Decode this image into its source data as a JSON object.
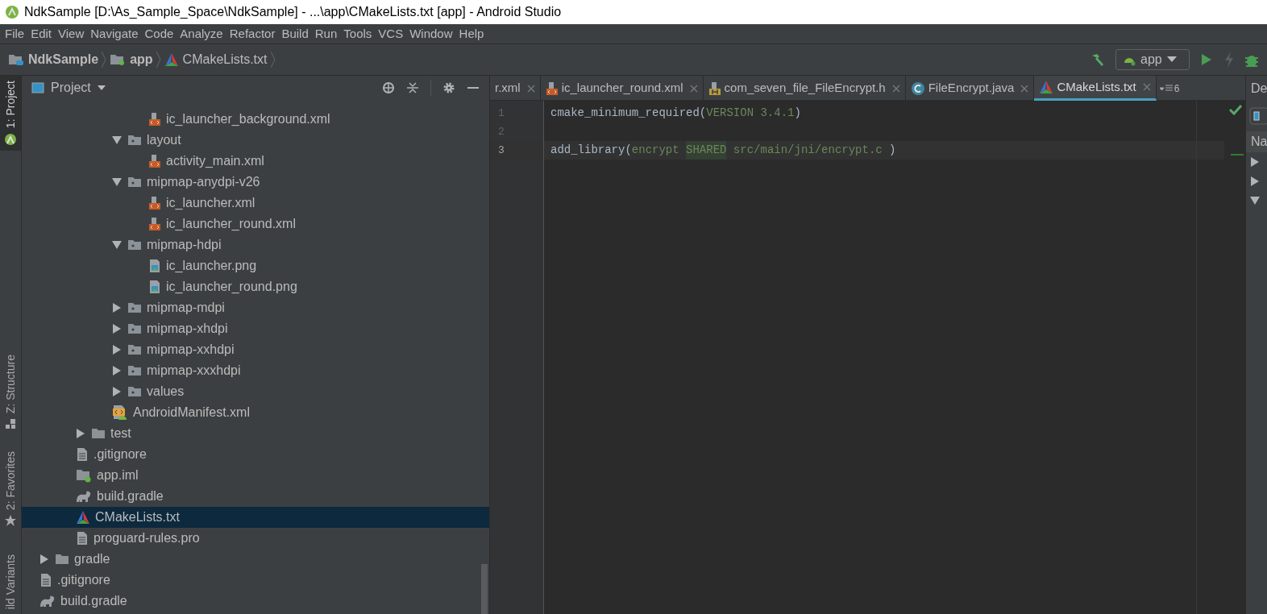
{
  "window": {
    "title": "NdkSample [D:\\As_Sample_Space\\NdkSample] - ...\\app\\CMakeLists.txt [app] - Android Studio"
  },
  "menu": [
    "File",
    "Edit",
    "View",
    "Navigate",
    "Code",
    "Analyze",
    "Refactor",
    "Build",
    "Run",
    "Tools",
    "VCS",
    "Window",
    "Help"
  ],
  "breadcrumbs": [
    {
      "label": "NdkSample",
      "kind": "project"
    },
    {
      "label": "app",
      "kind": "module"
    },
    {
      "label": "CMakeLists.txt",
      "kind": "cmake"
    }
  ],
  "run_config": {
    "label": "app"
  },
  "tool_strip": [
    {
      "label": "1: Project",
      "kind": "project",
      "selected": true
    },
    {
      "label": "Z: Structure",
      "kind": "structure",
      "selected": false
    },
    {
      "label": "2: Favorites",
      "kind": "favorites",
      "selected": false
    },
    {
      "label": "ild Variants",
      "kind": "variants",
      "selected": false
    }
  ],
  "project_panel": {
    "title": "Project"
  },
  "tree": [
    {
      "children": [
        {
          "children": [
            {
              "children": [
                {
                  "label": "ic_launcher_background.xml",
                  "kind": "xml",
                  "selected": false
                }
              ]
            },
            {
              "label": "layout",
              "kind": "folder",
              "expanded": true,
              "selected": false,
              "children": [
                {
                  "label": "activity_main.xml",
                  "kind": "xml",
                  "selected": false
                }
              ]
            },
            {
              "label": "mipmap-anydpi-v26",
              "kind": "folder",
              "expanded": true,
              "selected": false,
              "children": [
                {
                  "label": "ic_launcher.xml",
                  "kind": "xml",
                  "selected": false
                },
                {
                  "label": "ic_launcher_round.xml",
                  "kind": "xml",
                  "selected": false
                }
              ]
            },
            {
              "label": "mipmap-hdpi",
              "kind": "folder",
              "expanded": true,
              "selected": false,
              "children": [
                {
                  "label": "ic_launcher.png",
                  "kind": "png",
                  "selected": false
                },
                {
                  "label": "ic_launcher_round.png",
                  "kind": "png",
                  "selected": false
                }
              ]
            },
            {
              "label": "mipmap-mdpi",
              "kind": "folder",
              "expanded": false,
              "selected": false
            },
            {
              "label": "mipmap-xhdpi",
              "kind": "folder",
              "expanded": false,
              "selected": false
            },
            {
              "label": "mipmap-xxhdpi",
              "kind": "folder",
              "expanded": false,
              "selected": false
            },
            {
              "label": "mipmap-xxxhdpi",
              "kind": "folder",
              "expanded": false,
              "selected": false
            },
            {
              "label": "values",
              "kind": "folder",
              "expanded": false,
              "selected": false
            },
            {
              "label": "AndroidManifest.xml",
              "kind": "manifest",
              "selected": false
            }
          ]
        },
        {
          "label": "test",
          "kind": "plainfolder",
          "expanded": false,
          "selected": false
        },
        {
          "label": ".gitignore",
          "kind": "text",
          "selected": false
        },
        {
          "label": "app.iml",
          "kind": "iml",
          "selected": false
        },
        {
          "label": "build.gradle",
          "kind": "gradle",
          "selected": false
        },
        {
          "label": "CMakeLists.txt",
          "kind": "cmake",
          "selected": true
        },
        {
          "label": "proguard-rules.pro",
          "kind": "text",
          "selected": false
        }
      ]
    },
    {
      "label": "gradle",
      "kind": "plainfolder",
      "expanded": false,
      "selected": false
    },
    {
      "label": ".gitignore",
      "kind": "text",
      "selected": false
    },
    {
      "label": "build.gradle",
      "kind": "gradle",
      "selected": false
    }
  ],
  "editor_tabs": [
    {
      "label": "r.xml",
      "kind": "none",
      "selected": false
    },
    {
      "label": "ic_launcher_round.xml",
      "kind": "xml",
      "selected": false
    },
    {
      "label": "com_seven_file_FileEncrypt.h",
      "kind": "header",
      "selected": false
    },
    {
      "label": "FileEncrypt.java",
      "kind": "java",
      "selected": false
    },
    {
      "label": "CMakeLists.txt",
      "kind": "cmake",
      "selected": true
    }
  ],
  "tab_overflow": {
    "count": "6"
  },
  "code_lines": [
    {
      "number": "1",
      "current": false,
      "tokens": [
        {
          "text": "cmake_minimum_required(",
          "kind": "plain"
        },
        {
          "text": "VERSION 3.4.1",
          "kind": "arg"
        },
        {
          "text": ")",
          "kind": "plain"
        }
      ]
    },
    {
      "number": "2",
      "current": false
    },
    {
      "number": "3",
      "current": true,
      "tokens": [
        {
          "text": "add_library(",
          "kind": "plain"
        },
        {
          "text": "encrypt ",
          "kind": "arg"
        },
        {
          "text": "SHARED",
          "kind": "keyword"
        },
        {
          "text": " src/main/jni/encrypt.c ",
          "kind": "arg"
        },
        {
          "text": ")",
          "kind": "plain"
        }
      ]
    }
  ],
  "right_panel": {
    "tab": "De",
    "header": "Na",
    "rows": [
      {
        "expanded": false
      },
      {
        "expanded": false
      },
      {
        "expanded": true
      }
    ]
  }
}
